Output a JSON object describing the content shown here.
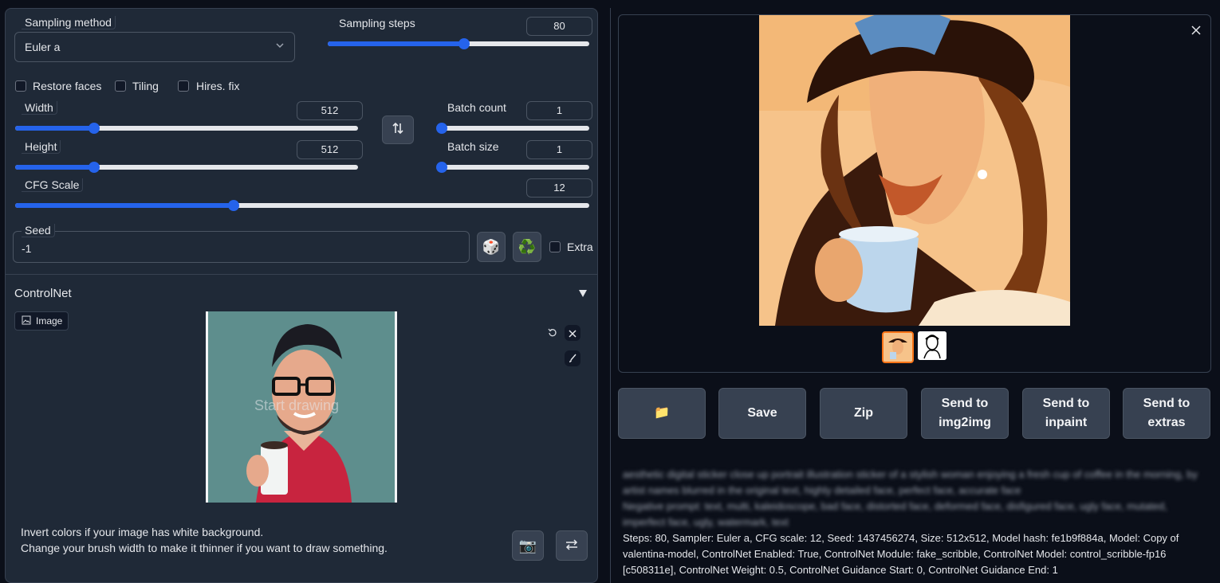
{
  "sampling": {
    "method_label": "Sampling method",
    "method_value": "Euler a",
    "steps_label": "Sampling steps",
    "steps_value": "80",
    "steps_fraction": 0.52
  },
  "checkboxes": {
    "restore_faces": "Restore faces",
    "tiling": "Tiling",
    "hires_fix": "Hires. fix"
  },
  "size": {
    "width_label": "Width",
    "width_value": "512",
    "height_label": "Height",
    "height_value": "512",
    "width_fraction": 0.23,
    "height_fraction": 0.23
  },
  "batch": {
    "count_label": "Batch count",
    "count_value": "1",
    "size_label": "Batch size",
    "size_value": "1"
  },
  "cfg": {
    "label": "CFG Scale",
    "value": "12",
    "fraction": 0.38
  },
  "seed": {
    "label": "Seed",
    "value": "-1",
    "extra_label": "Extra"
  },
  "controlnet": {
    "title": "ControlNet",
    "image_tab": "Image",
    "canvas_hint": "Start drawing",
    "info_line1": "Invert colors if your image has white background.",
    "info_line2": "Change your brush width to make it thinner if you want to draw something."
  },
  "output": {
    "buttons": {
      "folder_icon": "📁",
      "save": "Save",
      "zip": "Zip",
      "send_img2img": "Send to img2img",
      "send_inpaint": "Send to inpaint",
      "send_extras": "Send to extras"
    },
    "prompt_blurred_1": "aesthetic digital sticker close up portrait illustration sticker of a stylish woman enjoying a fresh cup of coffee in the morning, by",
    "prompt_blurred_2": "artist names blurred in the original text, highly detailed face, perfect face, accurate face",
    "prompt_blurred_3": "Negative prompt: text, multi, kaleidoscope, bad face, distorted face, deformed face, disfigured face, ugly face, mutated,",
    "prompt_blurred_4": "imperfect face, ugly, watermark, text",
    "params": "Steps: 80, Sampler: Euler a, CFG scale: 12, Seed: 1437456274, Size: 512x512, Model hash: fe1b9f884a, Model: Copy of valentina-model, ControlNet Enabled: True, ControlNet Module: fake_scribble, ControlNet Model: control_scribble-fp16 [c508311e], ControlNet Weight: 0.5, ControlNet Guidance Start: 0, ControlNet Guidance End: 1"
  },
  "colors": {
    "accent": "#2563eb",
    "panel": "#1f2937",
    "background": "#0b0f19",
    "thumb_selected_border": "#f97316"
  }
}
